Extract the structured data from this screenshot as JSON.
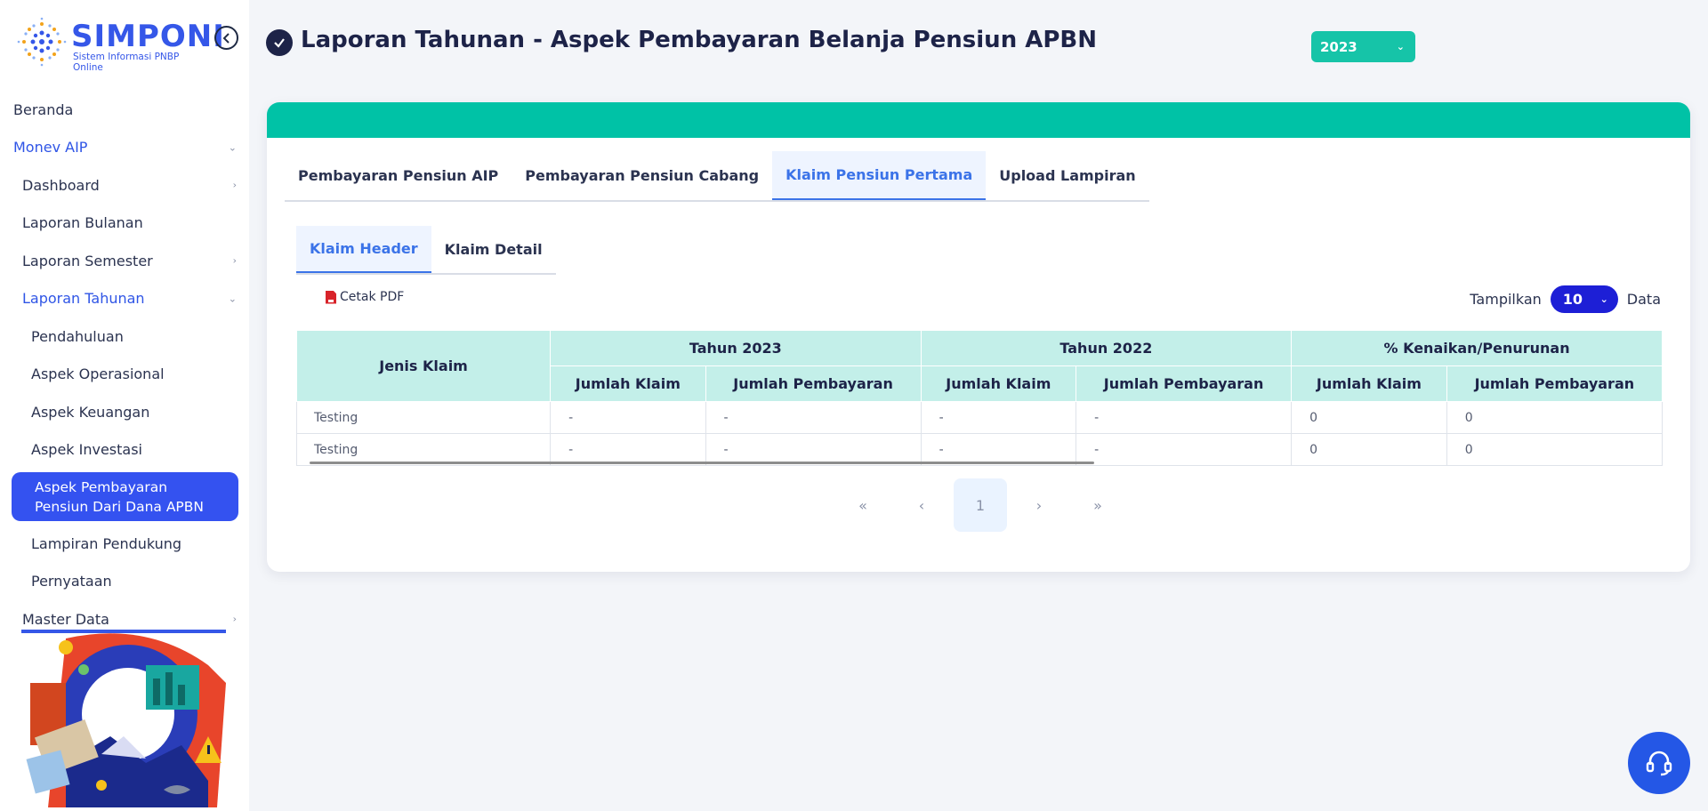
{
  "brand": {
    "name": "SIMPONI",
    "tagline": "Sistem Informasi PNBP Online"
  },
  "sidebar": {
    "items": [
      {
        "label": "Beranda"
      },
      {
        "label": "Monev AIP"
      },
      {
        "label": "Dashboard"
      },
      {
        "label": "Laporan Bulanan"
      },
      {
        "label": "Laporan Semester"
      },
      {
        "label": "Laporan Tahunan"
      },
      {
        "label": "Pendahuluan"
      },
      {
        "label": "Aspek Operasional"
      },
      {
        "label": "Aspek Keuangan"
      },
      {
        "label": "Aspek Investasi"
      },
      {
        "label": "Aspek Pembayaran Pensiun Dari Dana APBN"
      },
      {
        "label": "Lampiran Pendukung"
      },
      {
        "label": "Pernyataan"
      },
      {
        "label": "Master Data"
      }
    ]
  },
  "header": {
    "title": "Laporan Tahunan - Aspek Pembayaran Belanja Pensiun APBN",
    "year_selected": "2023"
  },
  "tabs": [
    {
      "label": "Pembayaran Pensiun AIP"
    },
    {
      "label": "Pembayaran Pensiun Cabang"
    },
    {
      "label": "Klaim Pensiun Pertama"
    },
    {
      "label": "Upload Lampiran"
    }
  ],
  "subtabs": [
    {
      "label": "Klaim Header"
    },
    {
      "label": "Klaim Detail"
    }
  ],
  "toolbar": {
    "pdf_label": "Cetak PDF",
    "show_label": "Tampilkan",
    "show_value": "10",
    "show_suffix": "Data"
  },
  "table": {
    "col_first": "Jenis Klaim",
    "groups": [
      "Tahun 2023",
      "Tahun 2022",
      "% Kenaikan/Penurunan"
    ],
    "subcols": [
      "Jumlah Klaim",
      "Jumlah Pembayaran",
      "Jumlah Klaim",
      "Jumlah Pembayaran",
      "Jumlah Klaim",
      "Jumlah Pembayaran"
    ],
    "rows": [
      [
        "Testing",
        "-",
        "-",
        "-",
        "-",
        "0",
        "0"
      ],
      [
        "Testing",
        "-",
        "-",
        "-",
        "-",
        "0",
        "0"
      ]
    ]
  },
  "pagination": {
    "first": "«",
    "prev": "‹",
    "current": "1",
    "next": "›",
    "last": "»"
  },
  "colors": {
    "accent_teal": "#00c2a6",
    "accent_blue": "#3452f0",
    "header_bg": "#c3efe9"
  }
}
